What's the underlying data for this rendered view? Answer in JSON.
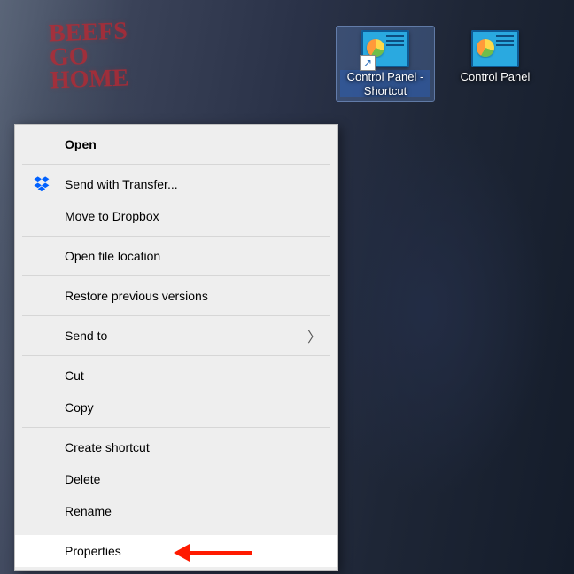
{
  "wallpaper": {
    "graffiti_lines": [
      "BEEFS",
      "GO",
      "HOME"
    ]
  },
  "desktop_icons": [
    {
      "label": "Control Panel - Shortcut",
      "selected": true,
      "is_shortcut": true
    },
    {
      "label": "Control Panel",
      "selected": false,
      "is_shortcut": false
    }
  ],
  "context_menu": {
    "groups": [
      [
        {
          "label": "Open",
          "bold": true
        }
      ],
      [
        {
          "label": "Send with Transfer...",
          "icon": "dropbox-icon"
        },
        {
          "label": "Move to Dropbox"
        }
      ],
      [
        {
          "label": "Open file location"
        }
      ],
      [
        {
          "label": "Restore previous versions"
        }
      ],
      [
        {
          "label": "Send to",
          "submenu": true
        }
      ],
      [
        {
          "label": "Cut"
        },
        {
          "label": "Copy"
        }
      ],
      [
        {
          "label": "Create shortcut"
        },
        {
          "label": "Delete"
        },
        {
          "label": "Rename"
        }
      ],
      [
        {
          "label": "Properties",
          "hover": true,
          "annotated": true
        }
      ]
    ]
  }
}
